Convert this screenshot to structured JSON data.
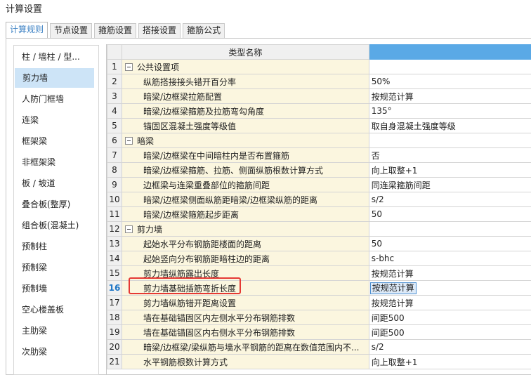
{
  "window": {
    "title": "计算设置"
  },
  "tabs": [
    {
      "label": "计算规则"
    },
    {
      "label": "节点设置"
    },
    {
      "label": "箍筋设置"
    },
    {
      "label": "搭接设置"
    },
    {
      "label": "箍筋公式"
    }
  ],
  "sidebar": {
    "items": [
      "柱 / 墙柱 / 型...",
      "剪力墙",
      "人防门框墙",
      "连梁",
      "框架梁",
      "非框架梁",
      "板 / 坡道",
      "叠合板(整厚)",
      "组合板(混凝土)",
      "预制柱",
      "预制梁",
      "预制墙",
      "空心楼盖板",
      "主肋梁",
      "次肋梁"
    ],
    "selected": "剪力墙"
  },
  "grid": {
    "header": {
      "name": "类型名称",
      "value": ""
    },
    "rows": [
      {
        "num": "1",
        "name": "公共设置项",
        "value": "",
        "group": true
      },
      {
        "num": "2",
        "name": "纵筋搭接接头错开百分率",
        "value": "50%"
      },
      {
        "num": "3",
        "name": "暗梁/边框梁拉筋配置",
        "value": "按规范计算"
      },
      {
        "num": "4",
        "name": "暗梁/边框梁箍筋及拉筋弯勾角度",
        "value": "135°"
      },
      {
        "num": "5",
        "name": "锚固区混凝土强度等级值",
        "value": "取自身混凝土强度等级"
      },
      {
        "num": "6",
        "name": "暗梁",
        "value": "",
        "group": true
      },
      {
        "num": "7",
        "name": "暗梁/边框梁在中间暗柱内是否布置箍筋",
        "value": "否"
      },
      {
        "num": "8",
        "name": "暗梁/边框梁箍筋、拉筋、侧面纵筋根数计算方式",
        "value": "向上取整+1"
      },
      {
        "num": "9",
        "name": "边框梁与连梁重叠部位的箍筋间距",
        "value": "同连梁箍筋间距"
      },
      {
        "num": "10",
        "name": "暗梁/边框梁侧面纵筋距暗梁/边框梁纵筋的距离",
        "value": "s/2"
      },
      {
        "num": "11",
        "name": "暗梁/边框梁箍筋起步距离",
        "value": "50"
      },
      {
        "num": "12",
        "name": "剪力墙",
        "value": "",
        "group": true
      },
      {
        "num": "13",
        "name": "起始水平分布钢筋距楼面的距离",
        "value": "50"
      },
      {
        "num": "14",
        "name": "起始竖向分布钢筋距暗柱边的距离",
        "value": "s-bhc"
      },
      {
        "num": "15",
        "name": "剪力墙纵筋露出长度",
        "value": "按规范计算"
      },
      {
        "num": "16",
        "name": "剪力墙基础插筋弯折长度",
        "value": "按规范计算",
        "current": true
      },
      {
        "num": "17",
        "name": "剪力墙纵筋错开距离设置",
        "value": "按规范计算"
      },
      {
        "num": "18",
        "name": "墙在基础锚固区内左侧水平分布钢筋排数",
        "value": "间距500"
      },
      {
        "num": "19",
        "name": "墙在基础锚固区内右侧水平分布钢筋排数",
        "value": "间距500"
      },
      {
        "num": "20",
        "name": "暗梁/边框梁/梁纵筋与墙水平钢筋的距离在数值范围内不...",
        "value": "s/2"
      },
      {
        "num": "21",
        "name": "水平钢筋根数计算方式",
        "value": "向上取整+1"
      }
    ]
  },
  "colors": {
    "accent": "#3e82c4",
    "header_highlight": "#5aa9e6",
    "name_cell_bg": "#fbf6df",
    "selected_sidebar_bg": "#cde4f7",
    "callout_border": "#e53935"
  },
  "icons": {
    "group_toggle": "collapse-minus-icon"
  }
}
